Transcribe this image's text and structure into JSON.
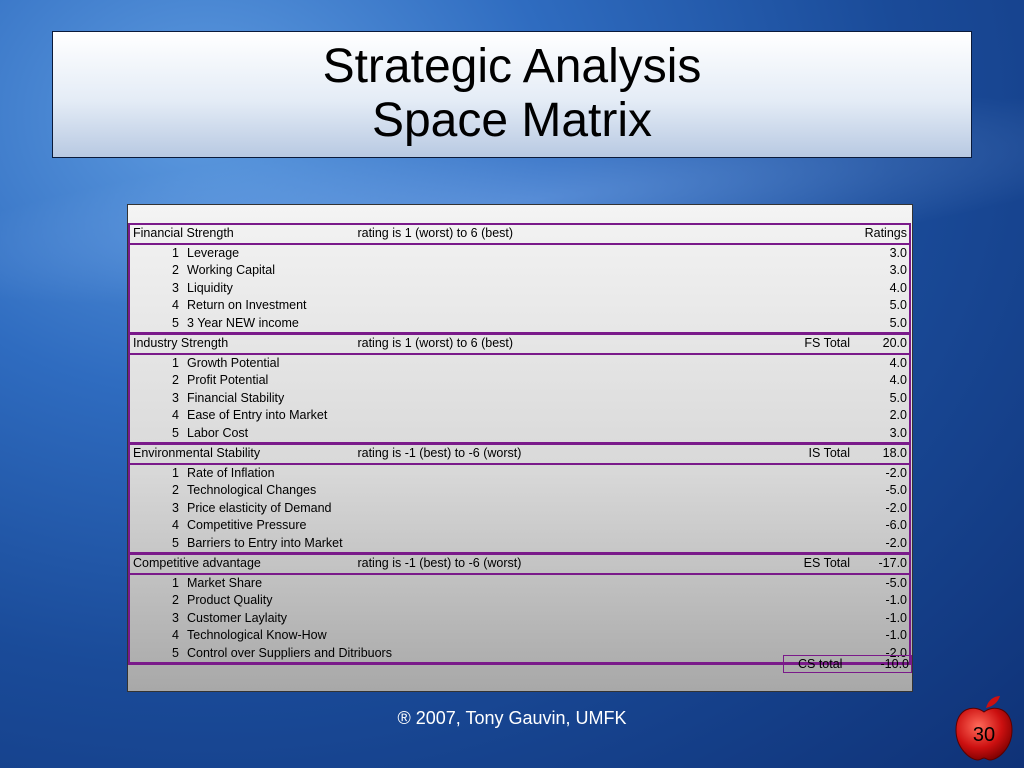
{
  "title": {
    "line1": "Strategic Analysis",
    "line2": "Space Matrix"
  },
  "sections": [
    {
      "name": "Financial Strength",
      "rating": "rating is 1 (worst) to 6 (best)",
      "total_label": "",
      "total_value": "Ratings",
      "items": [
        {
          "n": "1",
          "label": "Leverage",
          "value": "3.0"
        },
        {
          "n": "2",
          "label": "Working Capital",
          "value": "3.0"
        },
        {
          "n": "3",
          "label": "Liquidity",
          "value": "4.0"
        },
        {
          "n": "4",
          "label": "Return on Investment",
          "value": "5.0"
        },
        {
          "n": "5",
          "label": "3 Year NEW income",
          "value": "5.0"
        }
      ]
    },
    {
      "name": "Industry Strength",
      "rating": "rating is 1 (worst) to 6 (best)",
      "total_label": "FS Total",
      "total_value": "20.0",
      "items": [
        {
          "n": "1",
          "label": "Growth Potential",
          "value": "4.0"
        },
        {
          "n": "2",
          "label": "Profit Potential",
          "value": "4.0"
        },
        {
          "n": "3",
          "label": "Financial Stability",
          "value": "5.0"
        },
        {
          "n": "4",
          "label": "Ease of Entry into Market",
          "value": "2.0"
        },
        {
          "n": "5",
          "label": "Labor Cost",
          "value": "3.0"
        }
      ]
    },
    {
      "name": "Environmental Stability",
      "rating": "rating is -1 (best) to -6 (worst)",
      "total_label": "IS Total",
      "total_value": "18.0",
      "items": [
        {
          "n": "1",
          "label": "Rate of Inflation",
          "value": "-2.0"
        },
        {
          "n": "2",
          "label": "Technological Changes",
          "value": "-5.0"
        },
        {
          "n": "3",
          "label": "Price elasticity of Demand",
          "value": "-2.0"
        },
        {
          "n": "4",
          "label": "Competitive Pressure",
          "value": "-6.0"
        },
        {
          "n": "5",
          "label": "Barriers to Entry into Market",
          "value": "-2.0"
        }
      ]
    },
    {
      "name": "Competitive advantage",
      "rating": "rating is -1 (best) to -6 (worst)",
      "total_label": "ES Total",
      "total_value": "-17.0",
      "items": [
        {
          "n": "1",
          "label": "Market Share",
          "value": "-5.0"
        },
        {
          "n": "2",
          "label": "Product Quality",
          "value": "-1.0"
        },
        {
          "n": "3",
          "label": "Customer Laylaity",
          "value": "-1.0"
        },
        {
          "n": "4",
          "label": "Technological Know-How",
          "value": "-1.0"
        },
        {
          "n": "5",
          "label": "Control over Suppliers and Ditribuors",
          "value": "-2.0"
        }
      ]
    }
  ],
  "cs_total": {
    "label": "CS total",
    "value": "-10.0"
  },
  "footer": "® 2007, Tony Gauvin, UMFK",
  "slide_number": "30",
  "colors": {
    "accent": "#7a1a8a",
    "background": "#1a4b99",
    "apple_red": "#cc1010"
  }
}
